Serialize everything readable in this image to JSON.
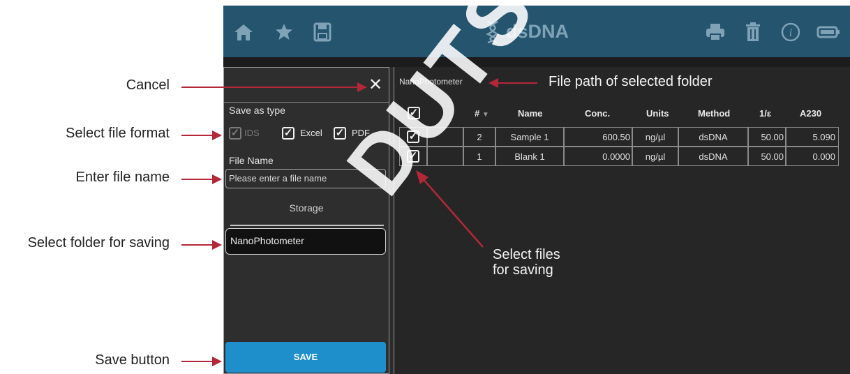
{
  "topbar": {
    "title": "dsDNA",
    "icons": [
      "home-icon",
      "star-icon",
      "save-icon",
      "dna-icon",
      "print-icon",
      "trash-icon",
      "info-icon",
      "battery-icon"
    ]
  },
  "save_panel": {
    "close_glyph": "✕",
    "save_as_type_label": "Save as type",
    "formats": [
      {
        "label": "IDS",
        "checked": true,
        "enabled": false
      },
      {
        "label": "Excel",
        "checked": true,
        "enabled": true
      },
      {
        "label": "PDF",
        "checked": true,
        "enabled": true
      }
    ],
    "file_name_label": "File Name",
    "file_name_placeholder": "Please enter a file name",
    "storage_tab": "Storage",
    "folder": "NanoPhotometer",
    "save_button": "SAVE"
  },
  "file_table": {
    "path": "NanoPhotometer",
    "headers": [
      "#",
      "Name",
      "Conc.",
      "Units",
      "Method",
      "1/ε",
      "A230"
    ],
    "rows": [
      {
        "checked": true,
        "num": "2",
        "name": "Sample 1",
        "conc": "600.50",
        "units": "ng/µl",
        "method": "dsDNA",
        "inv_e": "50.00",
        "a230": "5.090"
      },
      {
        "checked": true,
        "num": "1",
        "name": "Blank 1",
        "conc": "0.0000",
        "units": "ng/µl",
        "method": "dsDNA",
        "inv_e": "50.00",
        "a230": "0.000"
      }
    ]
  },
  "annotations": {
    "cancel": "Cancel",
    "select_format": "Select file format",
    "enter_name": "Enter file name",
    "select_folder": "Select folder for saving",
    "save_button": "Save button",
    "file_path": "File path of selected folder",
    "select_files_line1": "Select files",
    "select_files_line2": "for saving"
  },
  "watermark": "DUTSCHER",
  "colors": {
    "topbar": "#24546e",
    "accent_arrow": "#b32838",
    "save_button": "#1e8fca"
  }
}
